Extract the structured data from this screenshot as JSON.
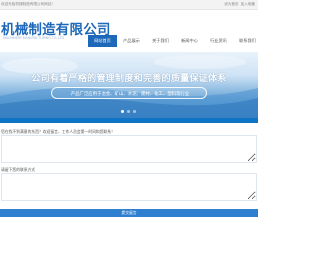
{
  "topbar": {
    "welcome": "欢迎光临机械制造有限公司网站！",
    "links": [
      "设为首页",
      "加入收藏"
    ]
  },
  "header": {
    "company_name": "机械制造有限公司",
    "company_en": "MACHINERY MANUFACTURING CO.,LTD"
  },
  "nav": {
    "items": [
      {
        "label": "网站首页",
        "active": true
      },
      {
        "label": "产品展示",
        "active": false
      },
      {
        "label": "关于我们",
        "active": false
      },
      {
        "label": "新闻中心",
        "active": false
      },
      {
        "label": "行业资讯",
        "active": false
      },
      {
        "label": "联系我们",
        "active": false
      }
    ]
  },
  "banner": {
    "headline": "公司有着严格的管理制度和完善的质量保证体系",
    "subline": "产品广泛应用于冶金、矿山、水泥、建材、化工、塑料等行业",
    "slides": 3,
    "active_slide": 1
  },
  "feedback": {
    "tip": "您在找不到满意的东西？欢迎留言，工作人员会第一时间和您联系！",
    "message_placeholder": "",
    "contact_label": "请留下您的联系方式",
    "contact_placeholder": "",
    "submit_label": "提交留言"
  },
  "colors": {
    "brand": "#1d68b8",
    "accent_bar": "#0e74c6",
    "button": "#2f7fd0"
  }
}
